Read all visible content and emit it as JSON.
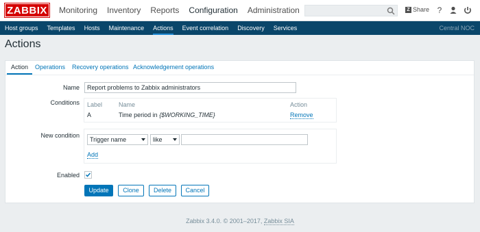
{
  "header": {
    "logo": "ZABBIX",
    "menu": [
      "Monitoring",
      "Inventory",
      "Reports",
      "Configuration",
      "Administration"
    ],
    "active_menu": "Configuration",
    "search_placeholder": "",
    "share_badge": "Z",
    "share_label": "Share",
    "help_glyph": "?",
    "icons": [
      "search-icon",
      "help-icon",
      "user-icon",
      "logout-icon"
    ]
  },
  "submenu": {
    "items": [
      "Host groups",
      "Templates",
      "Hosts",
      "Maintenance",
      "Actions",
      "Event correlation",
      "Discovery",
      "Services"
    ],
    "active": "Actions",
    "right_text": "Central NOC"
  },
  "page": {
    "title": "Actions"
  },
  "tabs": [
    "Action",
    "Operations",
    "Recovery operations",
    "Acknowledgement operations"
  ],
  "form": {
    "name_label": "Name",
    "name_value": "Report problems to Zabbix administrators",
    "conditions_label": "Conditions",
    "conditions_table": {
      "headers": [
        "Label",
        "Name",
        "Action"
      ],
      "rows": [
        {
          "label": "A",
          "name_prefix": "Time period in ",
          "name_macro": "{$WORKING_TIME}",
          "action": "Remove"
        }
      ]
    },
    "new_condition_label": "New condition",
    "condition_type": "Trigger name",
    "operator": "like",
    "value": "",
    "add_link": "Add",
    "enabled_label": "Enabled",
    "enabled_checked": true
  },
  "buttons": {
    "update": "Update",
    "clone": "Clone",
    "delete": "Delete",
    "cancel": "Cancel"
  },
  "footer": {
    "text": "Zabbix 3.4.0. © 2001–2017, ",
    "link": "Zabbix SIA"
  },
  "colors": {
    "brand_red": "#d40000",
    "nav_blue": "#0a466a",
    "link_blue": "#0275b8"
  }
}
